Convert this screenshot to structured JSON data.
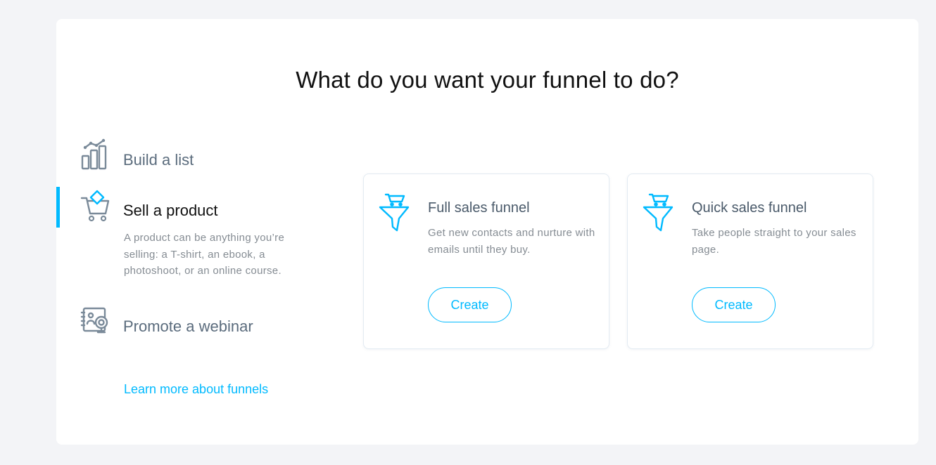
{
  "page": {
    "title": "What do you want your funnel to do?"
  },
  "goals": [
    {
      "label": "Build a list",
      "icon": "bar-chart-icon"
    },
    {
      "label": "Sell a product",
      "icon": "shopping-cart-icon",
      "description": "A product can be anything you’re selling: a T-shirt, an ebook, a photoshoot, or an online course.",
      "active": true
    },
    {
      "label": "Promote a webinar",
      "icon": "webinar-icon"
    }
  ],
  "learn_more_link": "Learn more about funnels",
  "funnel_cards": [
    {
      "title": "Full sales funnel",
      "description": "Get new contacts and nurture with emails until they buy.",
      "button_label": "Create",
      "icon": "funnel-cart-icon"
    },
    {
      "title": "Quick sales funnel",
      "description": "Take people straight to your sales page.",
      "button_label": "Create",
      "icon": "funnel-cart-icon"
    }
  ],
  "colors": {
    "accent": "#00baff",
    "icon_gray": "#7a8a99",
    "background": "#f3f4f7",
    "panel": "#ffffff"
  }
}
